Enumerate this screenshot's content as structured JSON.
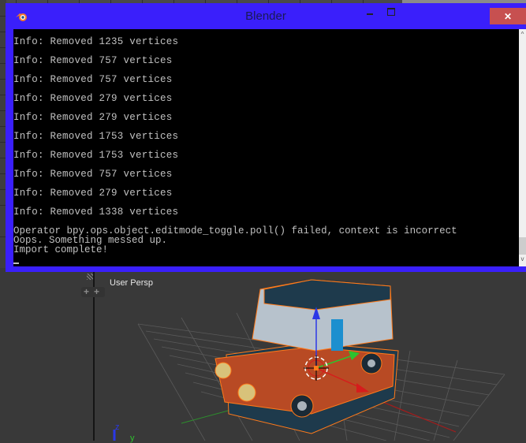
{
  "window": {
    "title": "Blender",
    "minimize_glyph": "–",
    "close_glyph": "✕",
    "accent_color": "#3a1ffb",
    "close_color": "#c75050"
  },
  "console": {
    "info_lines": [
      "Info: Removed 1235 vertices",
      "Info: Removed 757 vertices",
      "Info: Removed 757 vertices",
      "Info: Removed 279 vertices",
      "Info: Removed 279 vertices",
      "Info: Removed 1753 vertices",
      "Info: Removed 1753 vertices",
      "Info: Removed 757 vertices",
      "Info: Removed 279 vertices",
      "Info: Removed 1338 vertices"
    ],
    "tail_lines": [
      "Operator bpy.ops.object.editmode_toggle.poll() failed, context is incorrect",
      "Oops. Something messed up.",
      "Import complete!"
    ],
    "scroll_up_glyph": "^",
    "scroll_down_glyph": "v"
  },
  "viewport": {
    "label": "User Persp",
    "plus_glyph": "+",
    "axis_z": "z",
    "axis_y": "y",
    "selection_color": "#ff7a1a"
  }
}
